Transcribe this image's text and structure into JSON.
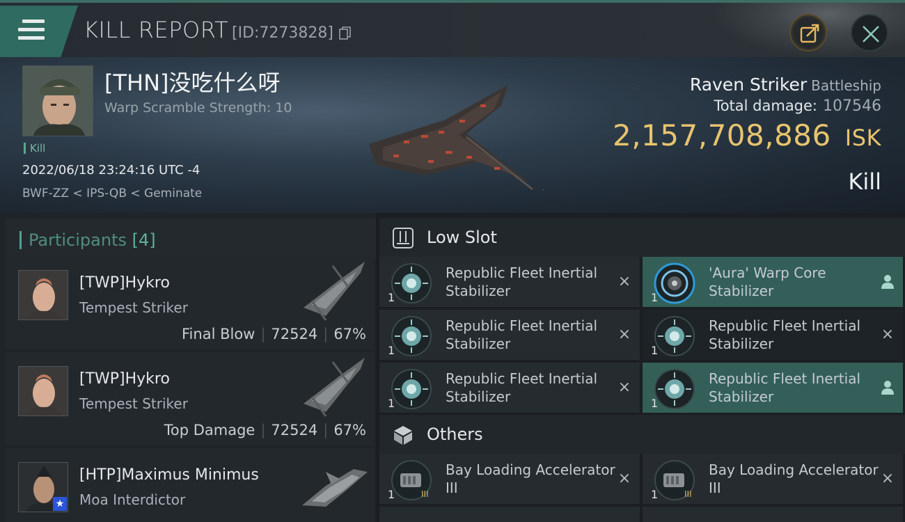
{
  "header": {
    "title": "KILL REPORT",
    "report_id": "[ID:7273828]",
    "icons": [
      "menu-icon",
      "copy-icon",
      "share-icon",
      "close-icon"
    ]
  },
  "victim": {
    "name": "[THN]没吃什么呀",
    "warp_scramble": "Warp Scramble Strength: 10",
    "tag": "Kill",
    "datetime": "2022/06/18 23:24:16 UTC -4",
    "location": "BWF-ZZ < IPS-QB < Geminate",
    "ship_name": "Raven Striker",
    "ship_class": "Battleship",
    "total_damage_label": "Total damage:",
    "total_damage_value": "107546",
    "isk_value": "2,157,708,886",
    "isk_unit": "ISK",
    "result": "Kill"
  },
  "participants": {
    "title": "Participants",
    "count": "[4]",
    "rows": [
      {
        "name": "[TWP]Hykro",
        "ship": "Tempest Striker",
        "role": "Final Blow",
        "damage": "72524",
        "percent": "67%"
      },
      {
        "name": "[TWP]Hykro",
        "ship": "Tempest Striker",
        "role": "Top Damage",
        "damage": "72524",
        "percent": "67%"
      },
      {
        "name": "[HTP]Maximus Minimus",
        "ship": "Moa Interdictor",
        "role": "",
        "damage": "",
        "percent": ""
      }
    ]
  },
  "slots": [
    {
      "title": "Low Slot",
      "icon": "low-slot-icon",
      "items": [
        {
          "qty": "1",
          "name": "Republic Fleet Inertial Stabilizer",
          "action": "×",
          "state": "destroyed"
        },
        {
          "qty": "1",
          "name": "'Aura' Warp Core Stabilizer",
          "action": "👤",
          "state": "dropped"
        },
        {
          "qty": "1",
          "name": "Republic Fleet Inertial Stabilizer",
          "action": "×",
          "state": "destroyed"
        },
        {
          "qty": "1",
          "name": "Republic Fleet Inertial Stabilizer",
          "action": "×",
          "state": "destroyed"
        },
        {
          "qty": "1",
          "name": "Republic Fleet Inertial Stabilizer",
          "action": "×",
          "state": "destroyed"
        },
        {
          "qty": "1",
          "name": "Republic Fleet Inertial Stabilizer",
          "action": "👤",
          "state": "dropped"
        }
      ]
    },
    {
      "title": "Others",
      "icon": "cargo-cube-icon",
      "items": [
        {
          "qty": "1",
          "name": "Bay Loading Accelerator III",
          "action": "×",
          "state": "destroyed"
        },
        {
          "qty": "1",
          "name": "Bay Loading Accelerator III",
          "action": "×",
          "state": "destroyed"
        }
      ]
    }
  ],
  "colors": {
    "accent": "#2f6b61",
    "isk": "#e7c46e",
    "highlight": "#335f58"
  }
}
